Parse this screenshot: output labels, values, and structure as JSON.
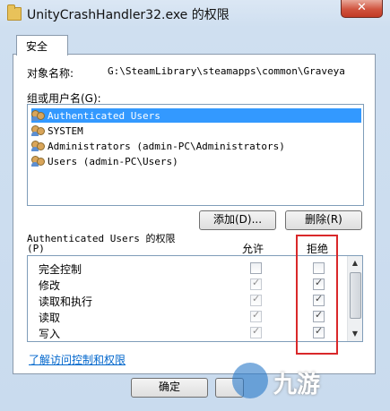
{
  "window": {
    "title": "UnityCrashHandler32.exe 的权限",
    "close_label": "✕"
  },
  "tabs": [
    {
      "label": "安全"
    }
  ],
  "object": {
    "label": "对象名称:",
    "value": "G:\\SteamLibrary\\steamapps\\common\\Graveya"
  },
  "groups": {
    "label": "组或用户名(G):",
    "items": [
      {
        "label": "Authenticated Users",
        "selected": true
      },
      {
        "label": "SYSTEM",
        "selected": false
      },
      {
        "label": "Administrators (admin-PC\\Administrators)",
        "selected": false
      },
      {
        "label": "Users (admin-PC\\Users)",
        "selected": false
      }
    ]
  },
  "buttons": {
    "add": "添加(D)...",
    "remove": "删除(R)",
    "ok": "确定"
  },
  "permissions": {
    "label": "Authenticated Users 的权限",
    "label_accel": "(P)",
    "allow_header": "允许",
    "deny_header": "拒绝",
    "rows": [
      {
        "name": "完全控制",
        "allow": false,
        "deny": false
      },
      {
        "name": "修改",
        "allow": true,
        "deny": true
      },
      {
        "name": "读取和执行",
        "allow": true,
        "deny": true
      },
      {
        "name": "读取",
        "allow": true,
        "deny": true
      },
      {
        "name": "写入",
        "allow": true,
        "deny": true
      }
    ]
  },
  "link": "了解访问控制和权限",
  "watermark": "九游",
  "colors": {
    "selection": "#3399ff",
    "highlight_box": "#d9282a",
    "link": "#0066cc"
  }
}
